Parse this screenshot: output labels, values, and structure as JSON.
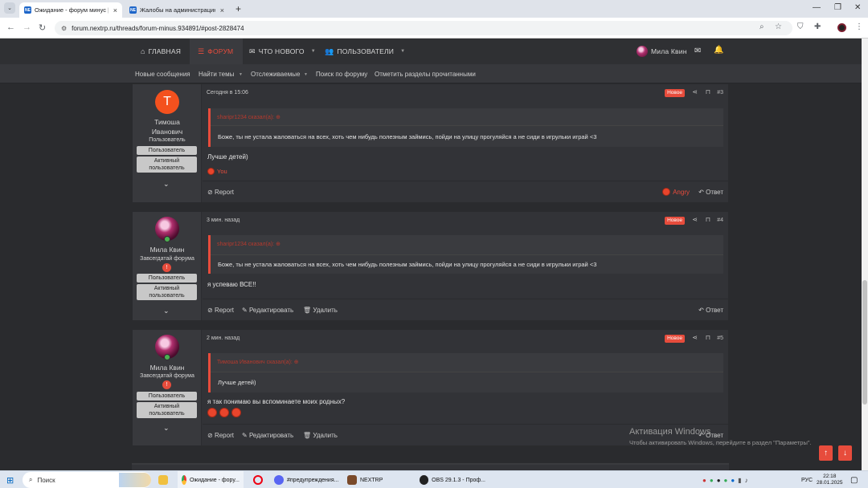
{
  "browser": {
    "tabs": [
      {
        "label": "Ожидание - форум минус | NE",
        "favicon": "NE",
        "active": true
      },
      {
        "label": "Жалобы на администрацию с",
        "favicon": "NE",
        "active": false
      }
    ],
    "new_tab": "+",
    "url": "forum.nextrp.ru/threads/forum-minus.934891/#post-2828474"
  },
  "nav": {
    "items": [
      {
        "label": "ГЛАВНАЯ",
        "icon": "home-icon"
      },
      {
        "label": "ФОРУМ",
        "icon": "forum-icon"
      },
      {
        "label": "ЧТО НОВОГО",
        "icon": "news-icon"
      },
      {
        "label": "ПОЛЬЗОВАТЕЛИ",
        "icon": "users-icon"
      }
    ],
    "user": "Мила Квин"
  },
  "subnav": [
    "Новые сообщения",
    "Найти темы",
    "Отслеживаемые",
    "Поиск по форуму",
    "Отметить разделы прочитанными"
  ],
  "posts": [
    {
      "author": {
        "name": "Тимоша Иванович",
        "letter": "T",
        "title": "Пользователь",
        "badges": [
          "Пользователь",
          "Активный пользователь"
        ]
      },
      "date": "Сегодня в 15:06",
      "new_label": "Новое",
      "number": "#3",
      "quote": {
        "header": "sharipr1234 сказал(а): ⊕",
        "text": "Боже, ты не устала жаловаться на всех, хоть чем нибудь полезным займись, пойди на улицу прогуляйся а не сиди в игрульки играй <3"
      },
      "text": "Лучше детей)",
      "reactions": "You",
      "actions": {
        "report": "Report",
        "reaction": "Angry",
        "reply": "Ответ"
      }
    },
    {
      "author": {
        "name": "Мила Квин",
        "title": "Завсегдатай форума",
        "badges": [
          "Пользователь",
          "Активный пользователь"
        ]
      },
      "date": "3 мин. назад",
      "new_label": "Новое",
      "number": "#4",
      "quote": {
        "header": "sharipr1234 сказал(а): ⊕",
        "text": "Боже, ты не устала жаловаться на всех, хоть чем нибудь полезным займись, пойди на улицу прогуляйся а не сиди в игрульки играй <3"
      },
      "text": "я успеваю ВСЕ!!",
      "actions": {
        "report": "Report",
        "edit": "Редактировать",
        "delete": "Удалить",
        "reply": "Ответ"
      }
    },
    {
      "author": {
        "name": "Мила Квин",
        "title": "Завсегдатай форума",
        "badges": [
          "Пользователь",
          "Активный пользователь"
        ]
      },
      "date": "2 мин. назад",
      "new_label": "Новое",
      "number": "#5",
      "quote": {
        "header": "Тимоша Иванович сказал(а): ⊕",
        "text": "Лучше детей)"
      },
      "text": "я так понимаю вы вспоминаете моих родных?",
      "actions": {
        "report": "Report",
        "edit": "Редактировать",
        "delete": "Удалить",
        "reply": "Ответ"
      }
    }
  ],
  "watermark": {
    "title": "Активация Windows",
    "subtitle": "Чтобы активировать Windows, перейдите в раздел \"Параметры\"."
  },
  "taskbar": {
    "search": "Поиск",
    "apps": [
      "Ожидание - фору...",
      "#предупреждения...",
      "NEXTRP",
      "OBS 29.1.3 - Проф..."
    ],
    "lang": "РУС",
    "time": "22:18",
    "date": "28.01.2025"
  },
  "colors": {
    "accent": "#e74c3c",
    "header_bg": "#2f3033",
    "post_bg": "#323337"
  }
}
